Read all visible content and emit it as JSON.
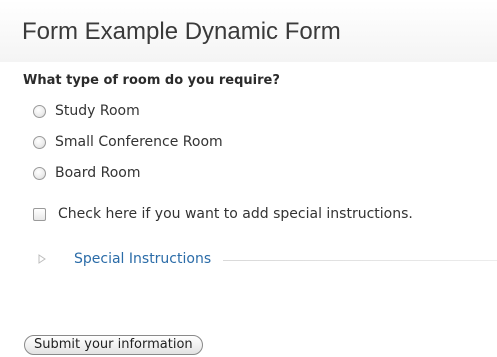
{
  "header": {
    "title": "Form Example Dynamic Form"
  },
  "form": {
    "question": "What type of room do you require?",
    "room_options": [
      {
        "label": "Study Room",
        "selected": false
      },
      {
        "label": "Small Conference Room",
        "selected": false
      },
      {
        "label": "Board Room",
        "selected": false
      }
    ],
    "special_instructions_checkbox": {
      "label": "Check here if you want to add special instructions.",
      "checked": false
    },
    "special_instructions_section": {
      "label": "Special Instructions",
      "expanded": false,
      "icon": "disclosure-triangle-right-icon"
    },
    "submit_label": "Submit your information"
  },
  "colors": {
    "link": "#2b6ca8",
    "text": "#333333"
  }
}
